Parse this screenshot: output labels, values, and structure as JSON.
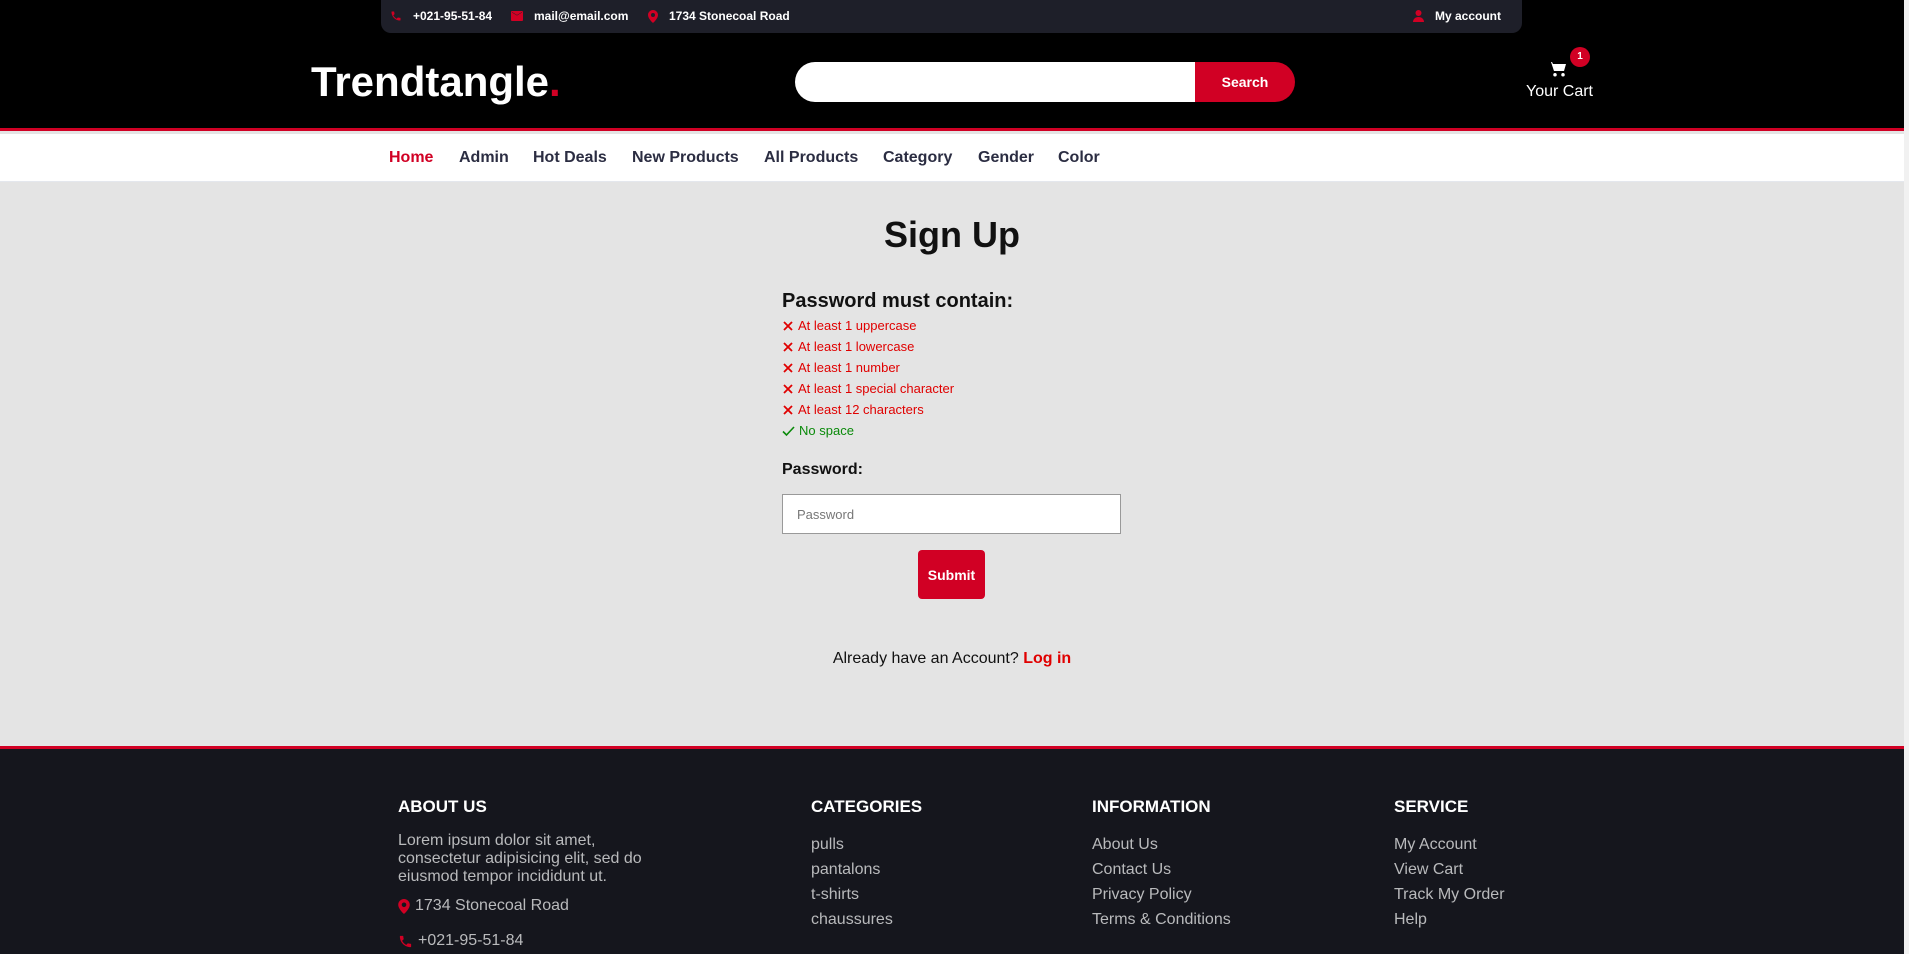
{
  "topbar": {
    "phone": "+021-95-51-84",
    "email": "mail@email.com",
    "address": "1734 Stonecoal Road",
    "account": "My account"
  },
  "brand": {
    "name": "Trendtangle",
    "dot": "."
  },
  "search": {
    "placeholder": "",
    "button": "Search"
  },
  "cart": {
    "count": "1",
    "label": "Your Cart"
  },
  "nav": {
    "items": [
      "Home",
      "Admin",
      "Hot Deals",
      "New Products",
      "All Products",
      "Category",
      "Gender",
      "Color"
    ],
    "active": "Home"
  },
  "form": {
    "title": "Sign Up",
    "rules_heading": "Password must contain:",
    "rules": [
      {
        "text": "At least 1 uppercase",
        "status": "fail"
      },
      {
        "text": "At least 1 lowercase",
        "status": "fail"
      },
      {
        "text": "At least 1 number",
        "status": "fail"
      },
      {
        "text": "At least 1 special character",
        "status": "fail"
      },
      {
        "text": "At least 12 characters",
        "status": "fail"
      },
      {
        "text": "No space",
        "status": "pass"
      }
    ],
    "password_label": "Password:",
    "password_placeholder": "Password",
    "password_value": "",
    "submit": "Submit",
    "already_text": "Already have an Account?",
    "login_link": "Log in"
  },
  "footer": {
    "about": {
      "heading": "ABOUT US",
      "text": "Lorem ipsum dolor sit amet, consectetur adipisicing elit, sed do eiusmod tempor incididunt ut.",
      "address": "1734 Stonecoal Road",
      "phone": "+021-95-51-84"
    },
    "categories": {
      "heading": "CATEGORIES",
      "links": [
        "pulls",
        "pantalons",
        "t-shirts",
        "chaussures"
      ]
    },
    "information": {
      "heading": "INFORMATION",
      "links": [
        "About Us",
        "Contact Us",
        "Privacy Policy",
        "Terms & Conditions"
      ]
    },
    "service": {
      "heading": "SERVICE",
      "links": [
        "My Account",
        "View Cart",
        "Track My Order",
        "Help"
      ]
    }
  },
  "colors": {
    "accent": "#d10024",
    "fail": "#e00000",
    "pass": "#0a8a0a",
    "header_bg": "#000000",
    "footer_bg": "#15161d"
  },
  "icons": [
    "phone-icon",
    "envelope-icon",
    "map-marker-icon",
    "user-icon",
    "shopping-cart-icon",
    "x-icon",
    "check-icon"
  ]
}
